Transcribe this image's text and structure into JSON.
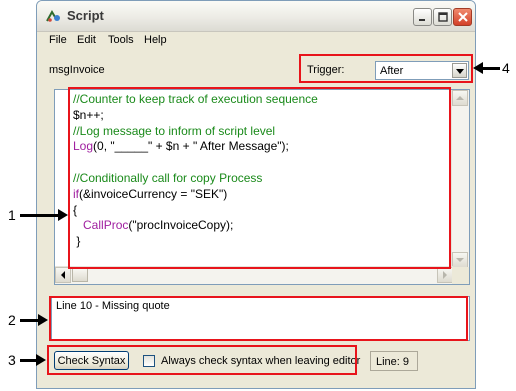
{
  "window": {
    "title": "Script"
  },
  "menu": [
    {
      "label": "File"
    },
    {
      "label": "Edit"
    },
    {
      "label": "Tools"
    },
    {
      "label": "Help"
    }
  ],
  "script_name": "msgInvoice",
  "trigger": {
    "label": "Trigger:",
    "value": "After"
  },
  "code_lines": [
    [
      {
        "t": "//Counter to keep track of execution sequence",
        "c": "comment"
      }
    ],
    [
      {
        "t": "$n++;",
        "c": "plain"
      }
    ],
    [
      {
        "t": "//Log message to inform of script level",
        "c": "comment"
      }
    ],
    [
      {
        "t": "Log",
        "c": "kw"
      },
      {
        "t": "(0, \"_____\" + $n + \" After Message\");",
        "c": "plain"
      }
    ],
    [
      {
        "t": "",
        "c": "plain"
      }
    ],
    [
      {
        "t": "//Conditionally call for copy Process",
        "c": "comment"
      }
    ],
    [
      {
        "t": "if",
        "c": "kw"
      },
      {
        "t": "(&invoiceCurrency = \"SEK\")",
        "c": "plain"
      }
    ],
    [
      {
        "t": "{",
        "c": "plain"
      }
    ],
    [
      {
        "t": "   ",
        "c": "plain"
      },
      {
        "t": "CallProc",
        "c": "kw"
      },
      {
        "t": "(\"procInvoiceCopy);",
        "c": "plain"
      }
    ],
    [
      {
        "t": " }",
        "c": "plain"
      }
    ]
  ],
  "error_message": "Line 10 - Missing quote",
  "check_syntax_label": "Check Syntax",
  "always_check_label": "Always check syntax when leaving editor",
  "always_check_checked": false,
  "line_indicator": "Line:  9",
  "callouts": {
    "one": "1",
    "two": "2",
    "three": "3",
    "four": "4"
  },
  "colors": {
    "highlight": "#e8141b",
    "comment": "#1a8a1a",
    "keyword": "#a020a0"
  }
}
